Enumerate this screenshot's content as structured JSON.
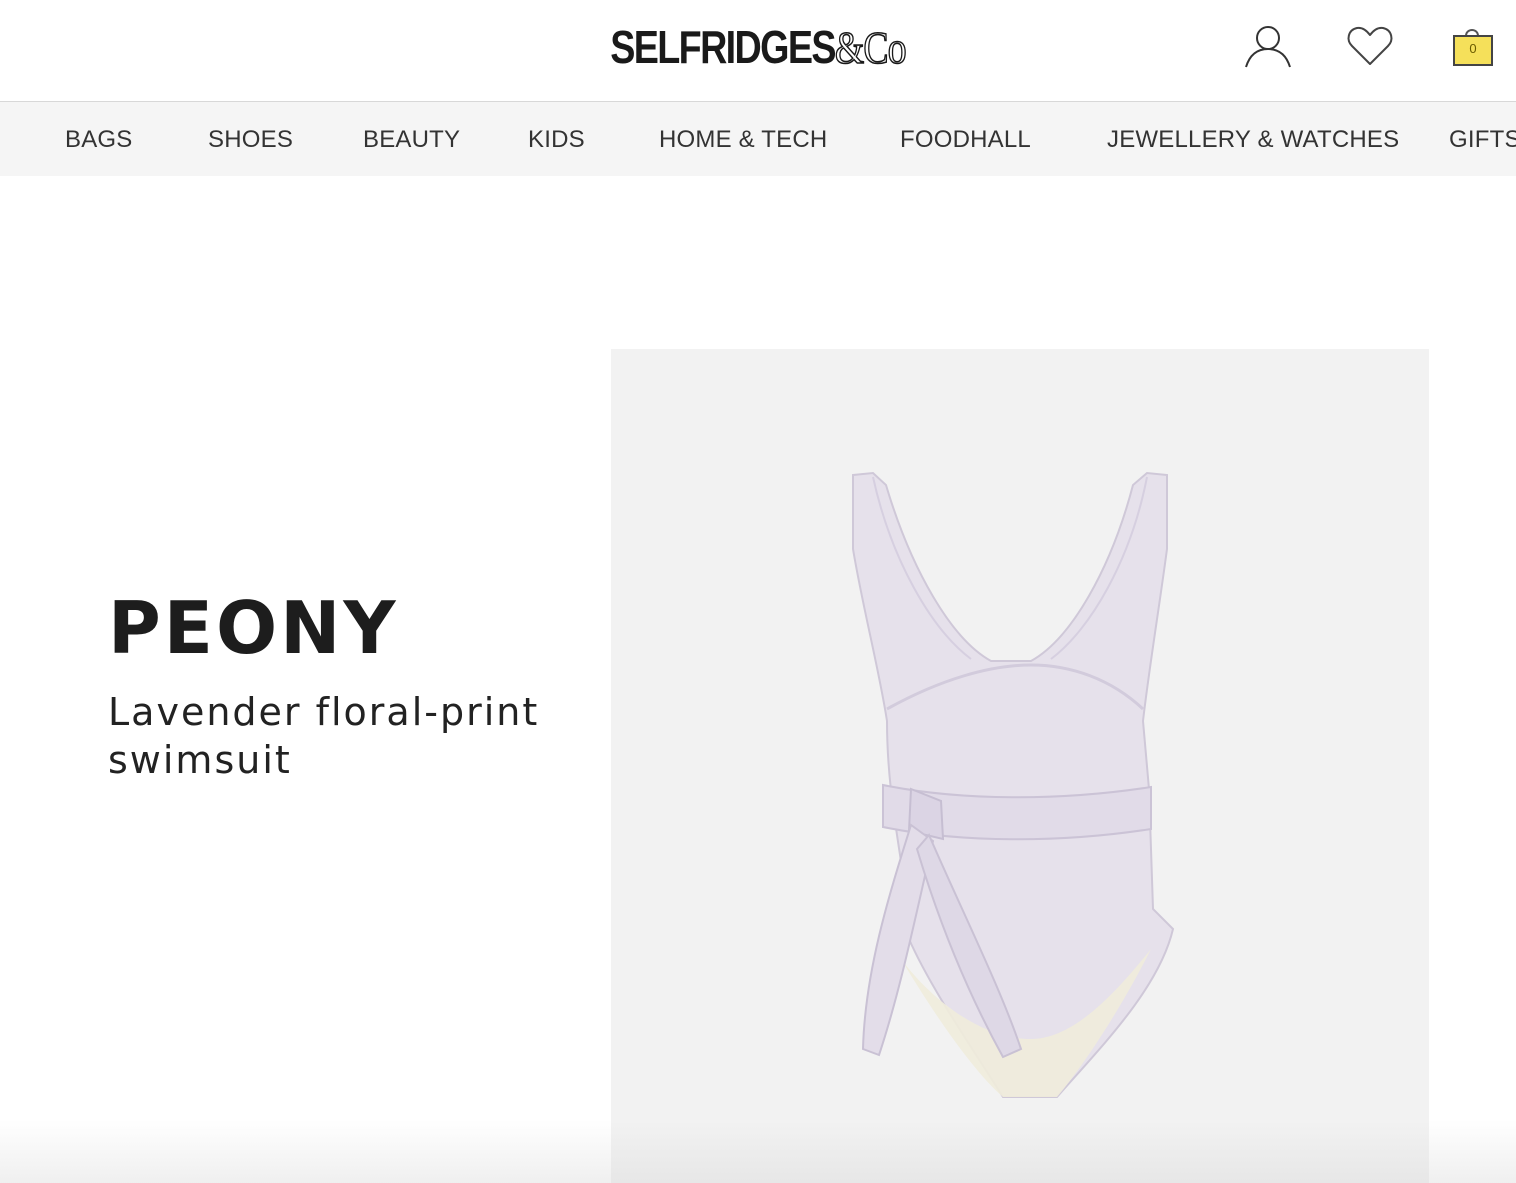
{
  "header": {
    "logo_main": "SELFRIDGES",
    "logo_suffix": "&Co",
    "icons": [
      "account-icon",
      "wishlist-heart-icon",
      "shopping-bag-icon"
    ],
    "bag_count": "0",
    "bag_color": "#f5e05a"
  },
  "nav": {
    "items": [
      {
        "label": "BAGS"
      },
      {
        "label": "SHOES"
      },
      {
        "label": "BEAUTY"
      },
      {
        "label": "KIDS"
      },
      {
        "label": "HOME & TECH"
      },
      {
        "label": "FOODHALL"
      },
      {
        "label": "JEWELLERY & WATCHES"
      },
      {
        "label": "GIFTS"
      }
    ]
  },
  "product": {
    "brand": "PEONY",
    "name": "Lavender floral-print swimsuit",
    "swimsuit_color": "#e6e1eb"
  }
}
